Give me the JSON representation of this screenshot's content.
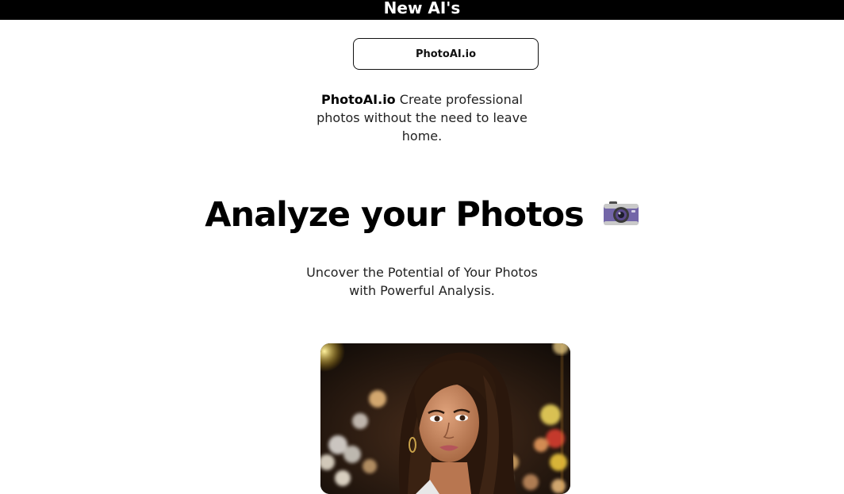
{
  "header": {
    "title": "New AI's"
  },
  "feature": {
    "button_label": "PhotoAI.io",
    "brand": "PhotoAI.io",
    "description": "Create professional photos without the need to leave home."
  },
  "hero": {
    "headline": "Analyze your Photos",
    "icon": "camera-icon",
    "subheadline": "Uncover the Potential of Your Photos with Powerful Analysis."
  },
  "colors": {
    "top_bar": "#000000",
    "background": "#ffffff",
    "camera_body": "#7366a8"
  }
}
